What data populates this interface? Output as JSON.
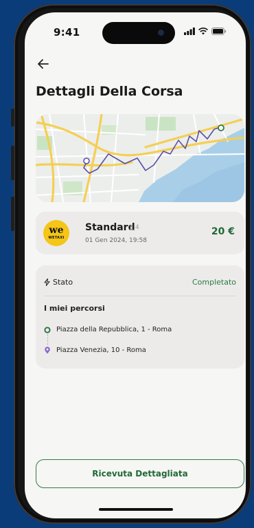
{
  "status_bar": {
    "time": "9:41"
  },
  "header": {
    "title": "Dettagli Della Corsa",
    "back_icon": "arrow-left-icon"
  },
  "ride": {
    "logo_mark": "we",
    "logo_text": "WETAXI",
    "service": "Standard",
    "seats": "4",
    "date": "01 Gen 2024, 19:58",
    "price": "20 €"
  },
  "details": {
    "status_label": "Stato",
    "status_value": "Completato",
    "routes_title": "I miei percorsi",
    "pickup": "Piazza della Repubblica, 1 - Roma",
    "dropoff": "Piazza Venezia, 10 - Roma"
  },
  "actions": {
    "receipt_label": "Ricevuta Dettagliata"
  },
  "colors": {
    "accent_green": "#1f6a37",
    "route_line": "#5b4fa6",
    "logo_yellow": "#f5c518",
    "background_blue": "#0b3c7a"
  }
}
